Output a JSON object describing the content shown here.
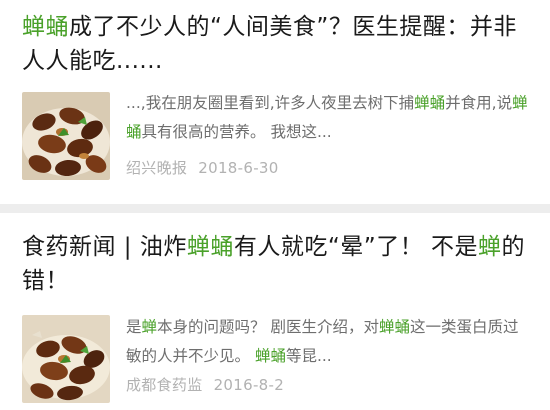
{
  "articles": [
    {
      "title_parts": [
        {
          "text": "蝉蛹",
          "hl": true
        },
        {
          "text": "成了不少人的“人间美食”？医生提醒：并非人人能吃......",
          "hl": false
        }
      ],
      "snippet_parts": [
        {
          "text": "...,我在朋友圈里看到,许多人夜里去树下捕",
          "hl": false
        },
        {
          "text": "蝉蛹",
          "hl": true
        },
        {
          "text": "并食用,说",
          "hl": false
        },
        {
          "text": "蝉蛹",
          "hl": true
        },
        {
          "text": "具有很高的营养。 我想这...",
          "hl": false
        }
      ],
      "source": "绍兴晚报",
      "date": "2018-6-30",
      "thumbnail_icon": "fried-cicada-photo"
    },
    {
      "title_parts": [
        {
          "text": "食药新闻 | 油炸",
          "hl": false
        },
        {
          "text": "蝉蛹",
          "hl": true
        },
        {
          "text": "有人就吃“晕”了！ 不是",
          "hl": false
        },
        {
          "text": "蝉",
          "hl": true
        },
        {
          "text": "的错！",
          "hl": false
        }
      ],
      "snippet_parts": [
        {
          "text": "是",
          "hl": false
        },
        {
          "text": "蝉",
          "hl": true
        },
        {
          "text": "本身的问题吗？ 剧医生介绍，对",
          "hl": false
        },
        {
          "text": "蝉蛹",
          "hl": true
        },
        {
          "text": "这一类蛋白质过敏的人并不少见。 ",
          "hl": false
        },
        {
          "text": "蝉蛹",
          "hl": true
        },
        {
          "text": "等昆...",
          "hl": false
        }
      ],
      "source": "成都食药监",
      "date": "2016-8-2",
      "thumbnail_icon": "fried-cicada-photo"
    }
  ],
  "colors": {
    "highlight": "#4aa12a",
    "title": "#1a1a1a",
    "snippet": "#6e6e6e",
    "meta": "#b2b2b2",
    "separator": "#ededed"
  }
}
